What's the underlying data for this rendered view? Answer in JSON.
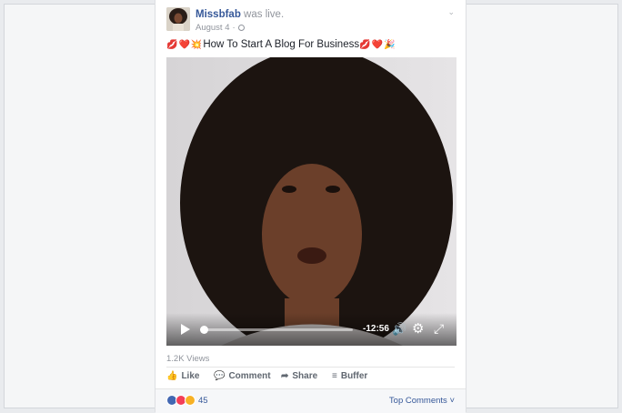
{
  "post": {
    "author": "Missbfab",
    "status": "was live.",
    "date": "August 4",
    "date_sep": "·",
    "title_prefix_emojis": [
      "💋",
      "❤️",
      "💥"
    ],
    "title": "How To Start A Blog For Business",
    "title_suffix_emojis": [
      "💋",
      "❤️",
      "🎉"
    ]
  },
  "video": {
    "time_remaining": "-12:56",
    "progress": 0.0
  },
  "views": "1.2K Views",
  "actions": {
    "like": "Like",
    "comment": "Comment",
    "share": "Share",
    "buffer": "Buffer"
  },
  "footer": {
    "reaction_count": "45",
    "top_comments": "Top Comments ˅"
  },
  "colors": {
    "link": "#365899",
    "like": "#4267b2",
    "love": "#f33e58",
    "haha": "#f7b125"
  }
}
